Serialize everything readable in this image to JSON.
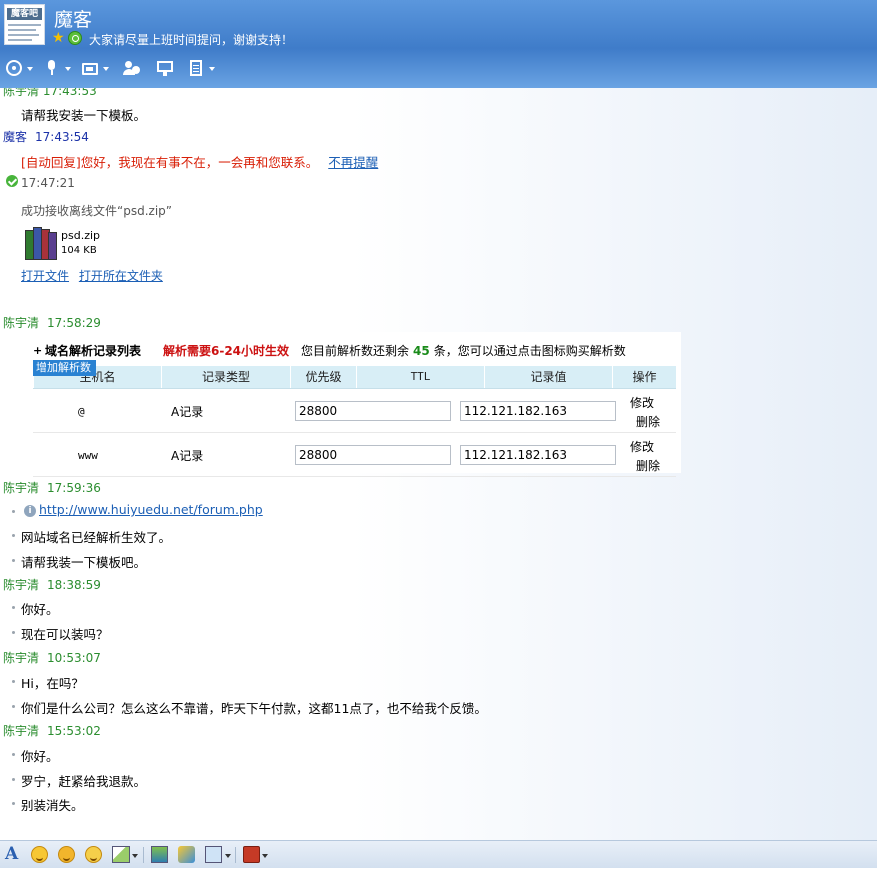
{
  "header": {
    "logo_text": "魔客吧",
    "title": "魔客",
    "signature": "大家请尽量上班时间提问，谢谢支持！"
  },
  "toolbar": {
    "icons": [
      "camera-icon",
      "microphone-icon",
      "file-transfer-icon",
      "add-contact-icon",
      "remote-desktop-icon",
      "notes-icon"
    ]
  },
  "chat": {
    "partial_header": "陈宇清  17:43:53",
    "m1": "请帮我安装一下模板。",
    "h2_name": "魔客",
    "h2_time": "17:43:54",
    "auto_reply": "[自动回复]您好，我现在有事不在，一会再和您联系。",
    "no_remind": "不再提醒",
    "sys_time": "17:47:21",
    "file_received": "成功接收离线文件“psd.zip”",
    "file_name": "psd.zip",
    "file_size": "104 KB",
    "open_file": "打开文件",
    "open_folder": "打开所在文件夹",
    "h3_name": "陈宇清",
    "h3_time": "17:58:29",
    "h4_name": "陈宇清",
    "h4_time": "17:59:36",
    "url": "http://www.huiyuedu.net/forum.php",
    "m2": "网站域名已经解析生效了。",
    "m3": "请帮我装一下模板吧。",
    "h5_name": "陈宇清",
    "h5_time": "18:38:59",
    "m4": "你好。",
    "m5": "现在可以装吗？",
    "h6_name": "陈宇清",
    "h6_time": "10:53:07",
    "m6": "Hi，在吗？",
    "m7": "你们是什么公司？怎么这么不靠谱，昨天下午付款，这都11点了，也不给我个反馈。",
    "h7_name": "陈宇清",
    "h7_time": "15:53:02",
    "m8": "你好。",
    "m9": "罗宁，赶紧给我退款。",
    "m10": "别装消失。"
  },
  "dns": {
    "plus": "+",
    "title": "域名解析记录列表",
    "note": "解析需要6-24小时生效",
    "rest_pre": "您目前解析数还剩余",
    "remaining": "45",
    "rest_post": "条，您可以通过点击图标购买解析数",
    "add_button": "增加解析数",
    "columns": [
      "主机名",
      "记录类型",
      "优先级",
      "TTL",
      "记录值",
      "操作"
    ],
    "rows": [
      {
        "host": "@",
        "type": "A记录",
        "ttl": "28800",
        "value": "112.121.182.163",
        "op1": "修改",
        "op2": "删除"
      },
      {
        "host": "www",
        "type": "A记录",
        "ttl": "28800",
        "value": "112.121.182.163",
        "op1": "修改",
        "op2": "删除"
      }
    ]
  },
  "bottom_toolbar": {
    "icons": [
      "font-icon",
      "emoticon-icon",
      "magic-face-icon",
      "wink-icon",
      "screenshot-icon",
      "image-icon",
      "music-icon",
      "send-image-icon",
      "toolbox-icon"
    ]
  },
  "colors": {
    "header_blue": "#3f7cc9",
    "name_green": "#2b8d2f",
    "name_blue": "#1c32a8",
    "auto_reply_red": "#d81e06",
    "link_blue": "#1c5fb5"
  }
}
